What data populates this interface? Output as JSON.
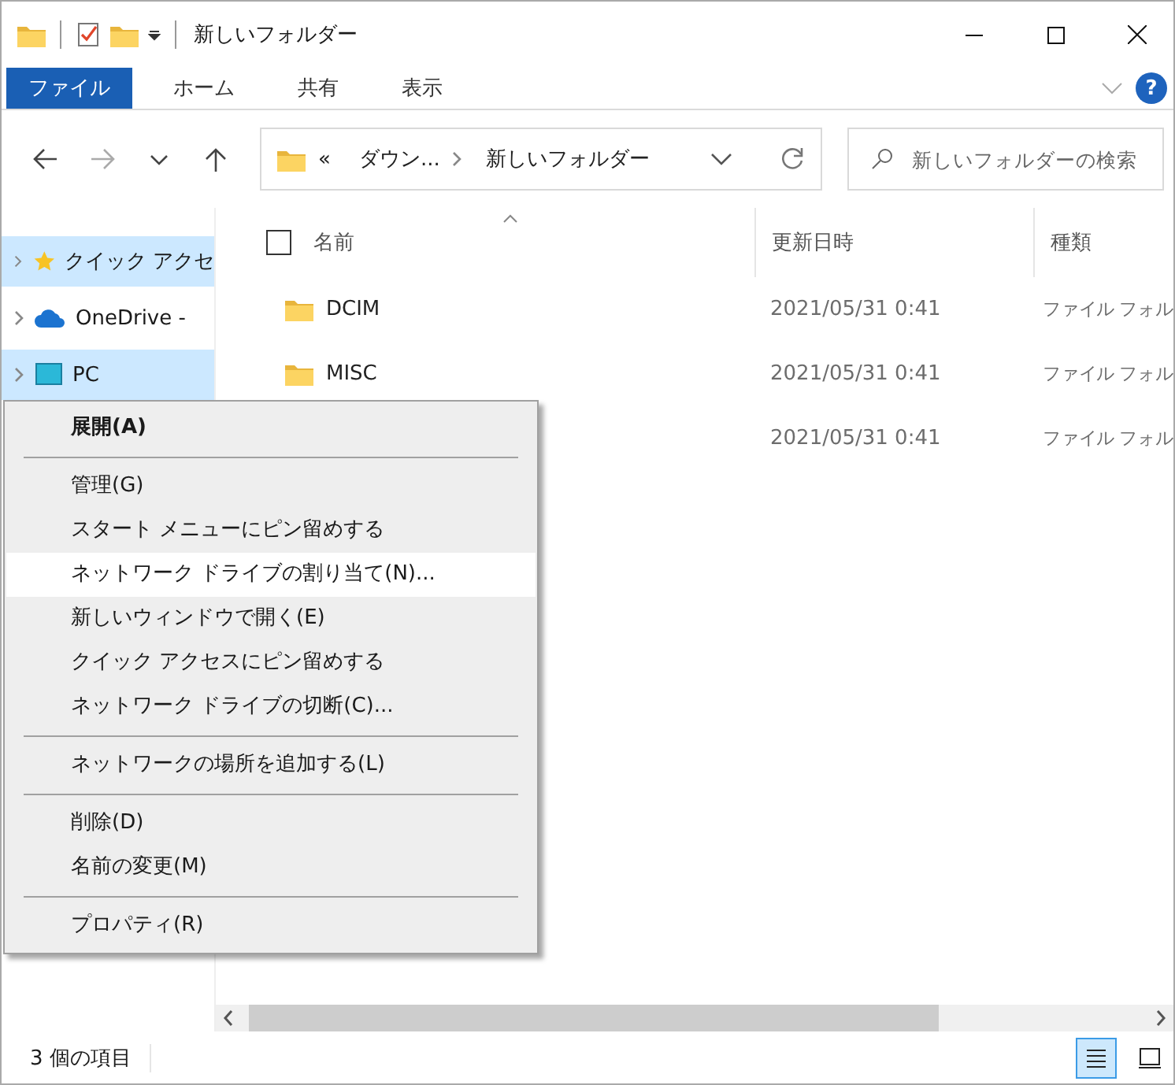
{
  "window": {
    "title": "新しいフォルダー"
  },
  "ribbon": {
    "tabs": [
      {
        "label": "ファイル",
        "selected": true
      },
      {
        "label": "ホーム",
        "selected": false
      },
      {
        "label": "共有",
        "selected": false
      },
      {
        "label": "表示",
        "selected": false
      }
    ],
    "help": "?"
  },
  "nav": {
    "back_disabled": false,
    "forward_disabled": true
  },
  "address": {
    "overflow": "«",
    "crumbs": [
      "ダウン...",
      "新しいフォルダー"
    ]
  },
  "search": {
    "placeholder": "新しいフォルダーの検索"
  },
  "sidebar": {
    "items": [
      {
        "label": "クイック アクセ",
        "selected": true
      },
      {
        "label": "OneDrive - ",
        "selected": false
      },
      {
        "label": "PC",
        "selected": true
      }
    ]
  },
  "table": {
    "select_all": {
      "checked": false
    },
    "columns": [
      "名前",
      "更新日時",
      "種類"
    ],
    "rows": [
      {
        "name": "DCIM",
        "modified": "2021/05/31 0:41",
        "type": "ファイル フォル"
      },
      {
        "name": "MISC",
        "modified": "2021/05/31 0:41",
        "type": "ファイル フォル"
      },
      {
        "modified": "2021/05/31 0:41",
        "type": "ファイル フォル"
      }
    ]
  },
  "context_menu": {
    "items": [
      {
        "kind": "item",
        "label": "展開(A)",
        "default": true,
        "selected": false
      },
      {
        "kind": "separator"
      },
      {
        "kind": "item",
        "label": "管理(G)",
        "default": false,
        "selected": false
      },
      {
        "kind": "item",
        "label": "スタート メニューにピン留めする",
        "default": false,
        "selected": false
      },
      {
        "kind": "item",
        "label": "ネットワーク ドライブの割り当て(N)...",
        "default": false,
        "selected": true
      },
      {
        "kind": "item",
        "label": "新しいウィンドウで開く(E)",
        "default": false,
        "selected": false
      },
      {
        "kind": "item",
        "label": "クイック アクセスにピン留めする",
        "default": false,
        "selected": false
      },
      {
        "kind": "item",
        "label": "ネットワーク ドライブの切断(C)...",
        "default": false,
        "selected": false
      },
      {
        "kind": "separator"
      },
      {
        "kind": "item",
        "label": "ネットワークの場所を追加する(L)",
        "default": false,
        "selected": false
      },
      {
        "kind": "separator"
      },
      {
        "kind": "item",
        "label": "削除(D)",
        "default": false,
        "selected": false
      },
      {
        "kind": "item",
        "label": "名前の変更(M)",
        "default": false,
        "selected": false
      },
      {
        "kind": "separator"
      },
      {
        "kind": "item",
        "label": "プロパティ(R)",
        "default": false,
        "selected": false
      }
    ]
  },
  "status_bar": {
    "count": "3 個の項目",
    "views": [
      {
        "selected": true
      },
      {
        "selected": false
      }
    ]
  }
}
